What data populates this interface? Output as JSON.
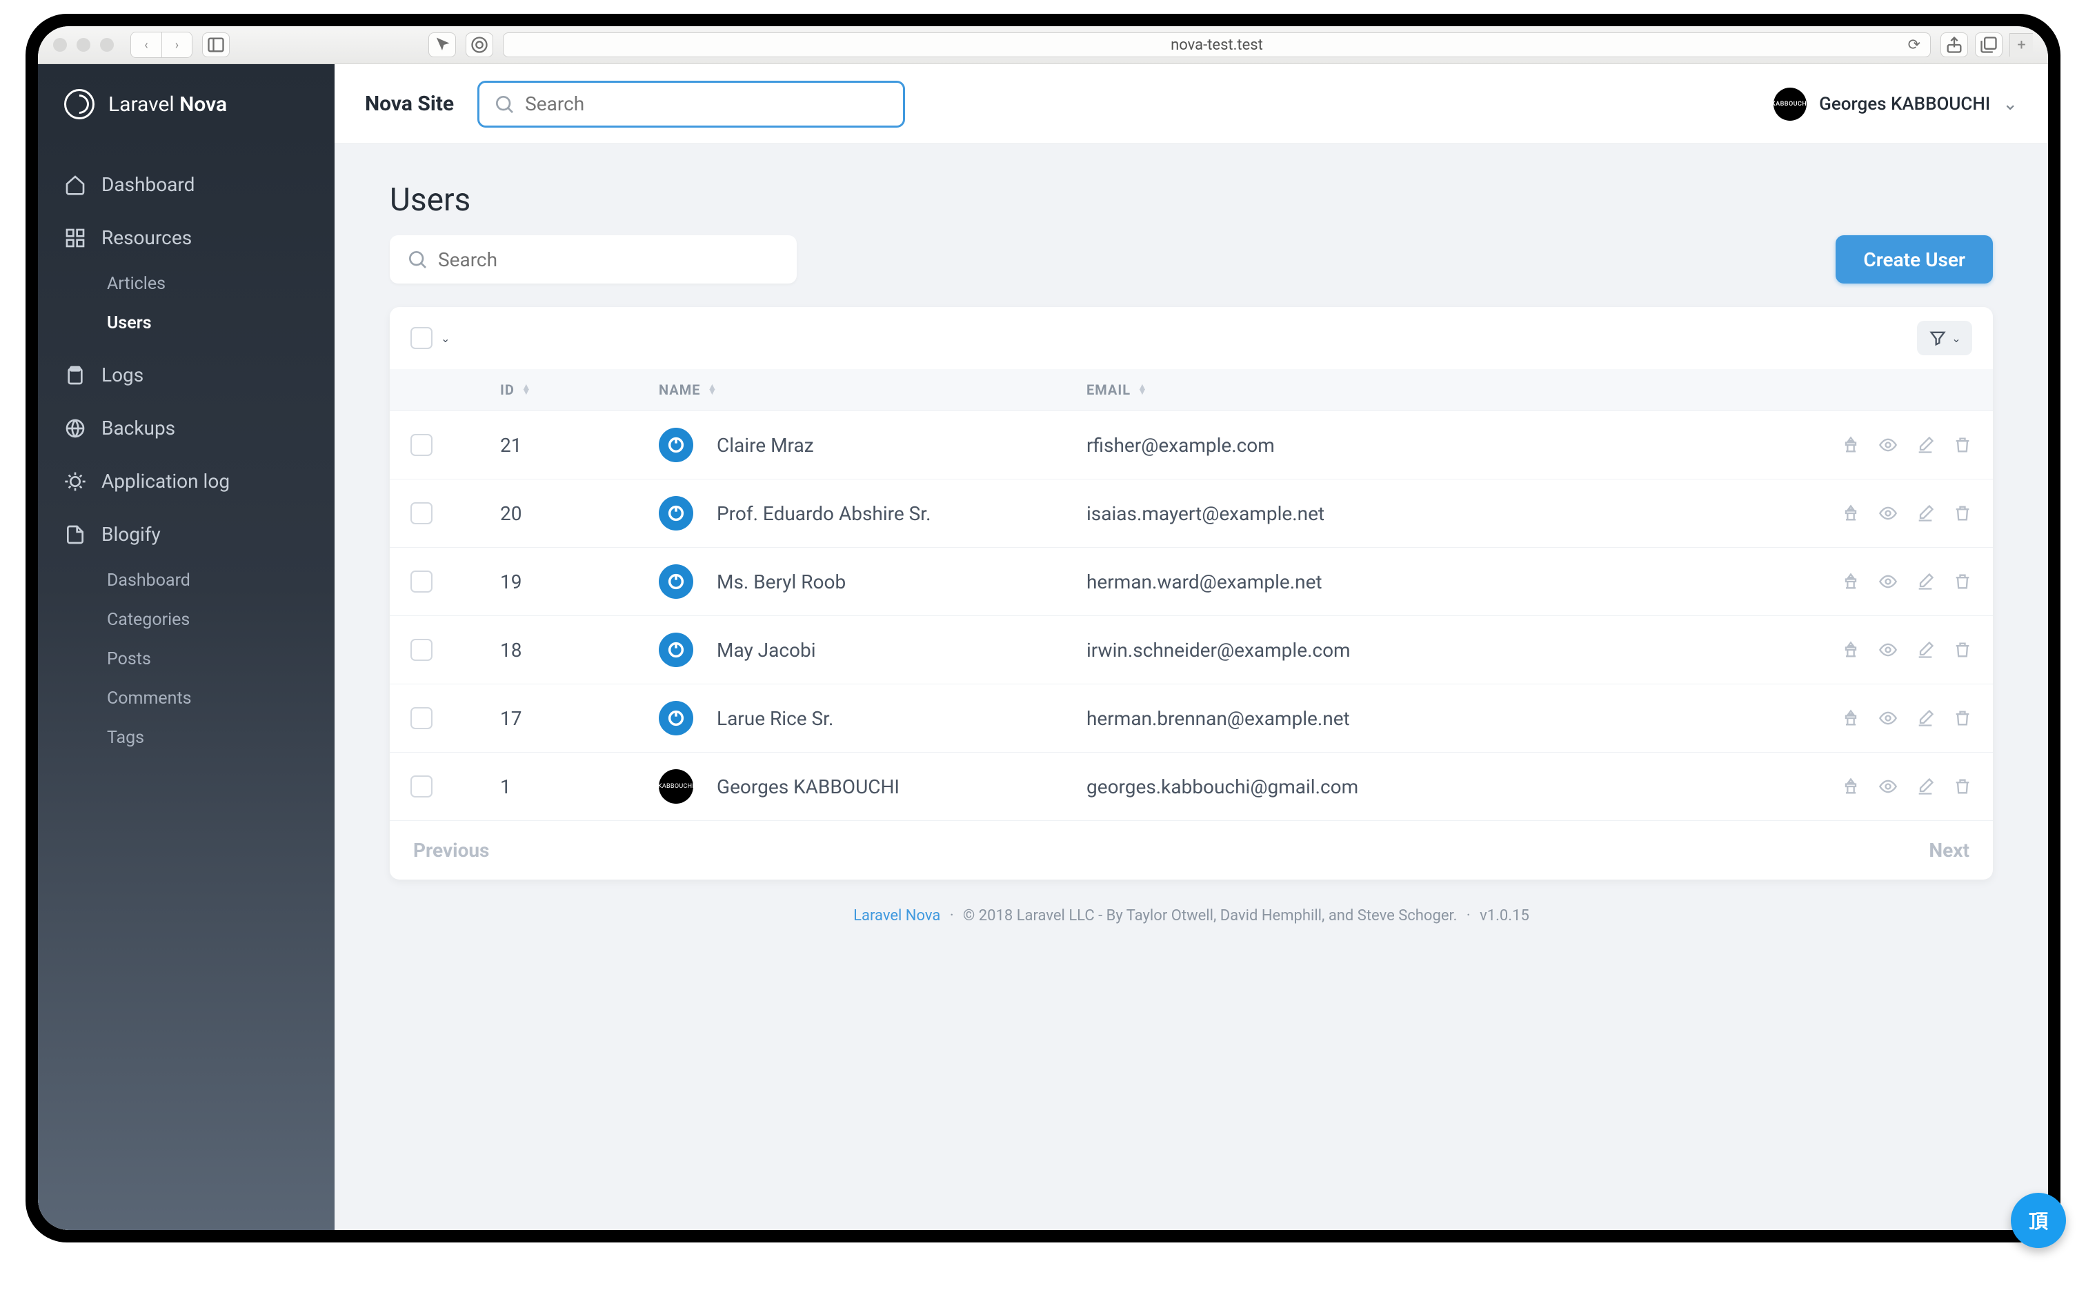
{
  "browser": {
    "url": "nova-test.test"
  },
  "app_name_a": "Laravel",
  "app_name_b": "Nova",
  "sidebar": {
    "dashboard": "Dashboard",
    "resources": "Resources",
    "resources_children": [
      "Articles",
      "Users"
    ],
    "logs": "Logs",
    "backups": "Backups",
    "applog": "Application log",
    "blogify": "Blogify",
    "blogify_children": [
      "Dashboard",
      "Categories",
      "Posts",
      "Comments",
      "Tags"
    ]
  },
  "topbar": {
    "site": "Nova Site",
    "search_placeholder": "Search",
    "user": "Georges KABBOUCHI"
  },
  "page": {
    "title": "Users",
    "search_placeholder": "Search",
    "create_btn": "Create User"
  },
  "table": {
    "headers": {
      "id": "ID",
      "name": "NAME",
      "email": "EMAIL"
    },
    "rows": [
      {
        "id": "21",
        "name": "Claire Mraz",
        "email": "rfisher@example.com",
        "avatar": "blue"
      },
      {
        "id": "20",
        "name": "Prof. Eduardo Abshire Sr.",
        "email": "isaias.mayert@example.net",
        "avatar": "blue"
      },
      {
        "id": "19",
        "name": "Ms. Beryl Roob",
        "email": "herman.ward@example.net",
        "avatar": "blue"
      },
      {
        "id": "18",
        "name": "May Jacobi",
        "email": "irwin.schneider@example.com",
        "avatar": "blue"
      },
      {
        "id": "17",
        "name": "Larue Rice Sr.",
        "email": "herman.brennan@example.net",
        "avatar": "blue"
      },
      {
        "id": "1",
        "name": "Georges KABBOUCHI",
        "email": "georges.kabbouchi@gmail.com",
        "avatar": "black"
      }
    ],
    "prev": "Previous",
    "next": "Next"
  },
  "footer": {
    "link": "Laravel Nova",
    "copyright": "© 2018 Laravel LLC - By Taylor Otwell, David Hemphill, and Steve Schoger.",
    "version": "v1.0.15"
  },
  "badge": "頂"
}
